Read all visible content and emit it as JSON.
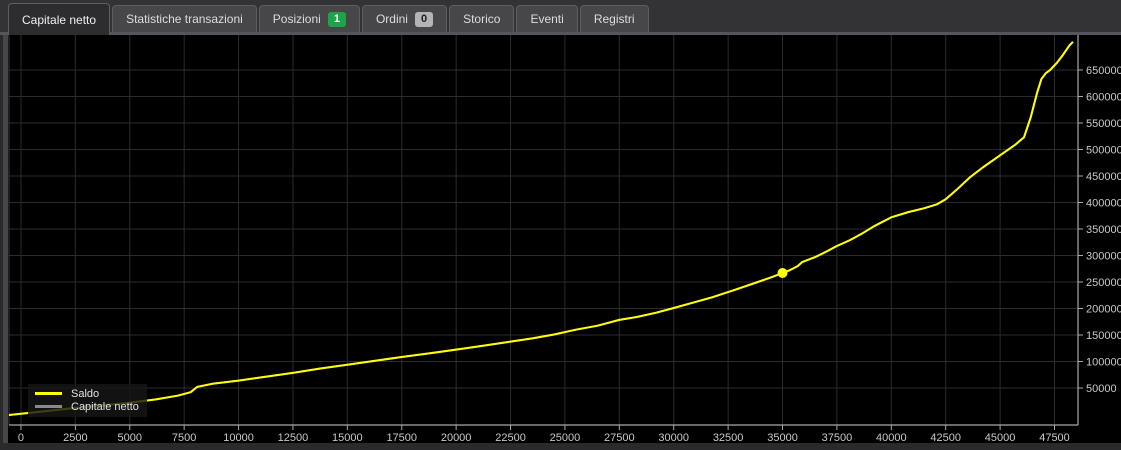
{
  "tabbar": {
    "tabs": [
      {
        "label": "Capitale netto",
        "active": true
      },
      {
        "label": "Statistiche transazioni",
        "active": false
      },
      {
        "label": "Posizioni",
        "active": false,
        "badge": "1",
        "badge_bg": "#1da44b",
        "badge_fg": "#ffffff"
      },
      {
        "label": "Ordini",
        "active": false,
        "badge": "0",
        "badge_bg": "#b4b4b6",
        "badge_fg": "#1e1e1e"
      },
      {
        "label": "Storico",
        "active": false
      },
      {
        "label": "Eventi",
        "active": false
      },
      {
        "label": "Registri",
        "active": false
      }
    ]
  },
  "colors": {
    "plot_background": "#000000",
    "grid": "#2c2c30",
    "frame": "#a8a8a8",
    "tick_label": "#c9c9c9",
    "saldo_line": "#ffff00",
    "capitale_netto_line": "#8a8a8a"
  },
  "chart_data": {
    "type": "line",
    "title": "",
    "xlabel": "",
    "ylabel": "",
    "grid": true,
    "xlim": [
      -550,
      48580
    ],
    "ylim": [
      -19800,
      716000
    ],
    "x_ticks": [
      0,
      2500,
      5000,
      7500,
      10000,
      12500,
      15000,
      17500,
      20000,
      22500,
      25000,
      27500,
      30000,
      32500,
      35000,
      37500,
      40000,
      42500,
      45000,
      47500
    ],
    "y_ticks": [
      50000,
      100000,
      150000,
      200000,
      250000,
      300000,
      350000,
      400000,
      450000,
      500000,
      550000,
      600000,
      650000
    ],
    "legend": {
      "position": "bottom-left",
      "entries": [
        {
          "label": "Saldo",
          "color": "#ffff00"
        },
        {
          "label": "Capitale netto",
          "color": "#8a8a8a"
        }
      ]
    },
    "note": "Both series overlap; the Capitale netto curve lies beneath the Saldo curve along the same points.",
    "curve_points": [
      [
        -550,
        -1000
      ],
      [
        0,
        1500
      ],
      [
        1300,
        7000
      ],
      [
        2500,
        12500
      ],
      [
        3800,
        17500
      ],
      [
        5000,
        22000
      ],
      [
        6200,
        28500
      ],
      [
        7200,
        35500
      ],
      [
        7800,
        42000
      ],
      [
        8100,
        52000
      ],
      [
        8800,
        58000
      ],
      [
        10000,
        64000
      ],
      [
        11200,
        71000
      ],
      [
        12500,
        78500
      ],
      [
        13800,
        87000
      ],
      [
        15000,
        94000
      ],
      [
        16200,
        101000
      ],
      [
        17500,
        108500
      ],
      [
        18800,
        115500
      ],
      [
        20000,
        122500
      ],
      [
        21200,
        129500
      ],
      [
        22500,
        137500
      ],
      [
        23500,
        143500
      ],
      [
        24500,
        151000
      ],
      [
        25500,
        160000
      ],
      [
        26500,
        167500
      ],
      [
        27500,
        178500
      ],
      [
        28300,
        184000
      ],
      [
        29200,
        192000
      ],
      [
        30000,
        201000
      ],
      [
        30800,
        210000
      ],
      [
        31800,
        221500
      ],
      [
        32800,
        235000
      ],
      [
        33800,
        249000
      ],
      [
        34500,
        259000
      ],
      [
        35000,
        267000
      ],
      [
        35300,
        271500
      ],
      [
        35700,
        280000
      ],
      [
        35900,
        287500
      ],
      [
        36500,
        297000
      ],
      [
        37000,
        307000
      ],
      [
        37500,
        318000
      ],
      [
        38100,
        329000
      ],
      [
        38600,
        340000
      ],
      [
        39200,
        355000
      ],
      [
        40000,
        372000
      ],
      [
        40800,
        382000
      ],
      [
        41500,
        389000
      ],
      [
        42100,
        396500
      ],
      [
        42500,
        406000
      ],
      [
        43000,
        424000
      ],
      [
        43600,
        447000
      ],
      [
        44200,
        466000
      ],
      [
        45000,
        489000
      ],
      [
        45700,
        509000
      ],
      [
        46100,
        523000
      ],
      [
        46400,
        560000
      ],
      [
        46700,
        607000
      ],
      [
        46900,
        633000
      ],
      [
        47100,
        644000
      ],
      [
        47300,
        650000
      ],
      [
        47600,
        663000
      ],
      [
        47900,
        679000
      ],
      [
        48200,
        697000
      ],
      [
        48350,
        703000
      ]
    ],
    "series": [
      {
        "name": "Capitale netto",
        "color": "#8a8a8a"
      },
      {
        "name": "Saldo",
        "color": "#ffff00"
      }
    ],
    "marker": {
      "x": 35000,
      "y": 267000,
      "color": "#ffff00",
      "radius": 5
    }
  }
}
